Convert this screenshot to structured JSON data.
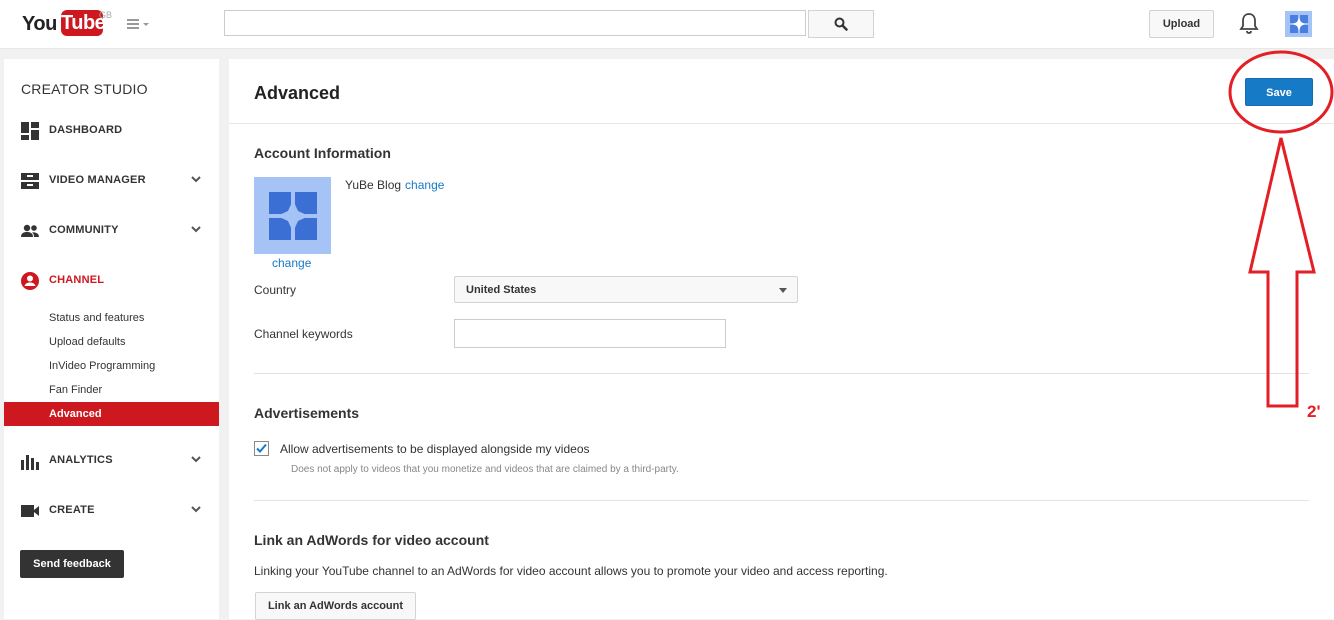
{
  "topbar": {
    "logo_you": "You",
    "logo_tube": "Tube",
    "region": "GB",
    "search_value": "",
    "upload_label": "Upload"
  },
  "sidebar": {
    "title": "CREATOR STUDIO",
    "nav": [
      {
        "label": "DASHBOARD",
        "icon": "dashboard-icon"
      },
      {
        "label": "VIDEO MANAGER",
        "icon": "video-manager-icon"
      },
      {
        "label": "COMMUNITY",
        "icon": "community-icon"
      },
      {
        "label": "CHANNEL",
        "icon": "channel-icon"
      },
      {
        "label": "ANALYTICS",
        "icon": "analytics-icon"
      },
      {
        "label": "CREATE",
        "icon": "create-icon"
      }
    ],
    "channel_sub": [
      "Status and features",
      "Upload defaults",
      "InVideo Programming",
      "Fan Finder",
      "Advanced"
    ],
    "feedback_label": "Send feedback"
  },
  "main": {
    "title": "Advanced",
    "save_label": "Save",
    "account": {
      "title": "Account Information",
      "channel_name": "YuBe Blog",
      "change_link": "change",
      "avatar_change": "change",
      "country_label": "Country",
      "country_value": "United States",
      "keywords_label": "Channel keywords",
      "keywords_value": ""
    },
    "ads": {
      "title": "Advertisements",
      "checkbox_label": "Allow advertisements to be displayed alongside my videos",
      "checked": true,
      "note": "Does not apply to videos that you monetize and videos that are claimed by a third-party."
    },
    "adwords": {
      "title": "Link an AdWords for video account",
      "text": "Linking your YouTube channel to an AdWords for video account allows you to promote your video and access reporting.",
      "button_label": "Link an AdWords account"
    }
  },
  "annotation": {
    "label": "2'",
    "color": "#e31e24"
  },
  "colors": {
    "accent_red": "#cc181e",
    "save_blue": "#167ac6",
    "avatar_bg": "#a6c3f5"
  }
}
